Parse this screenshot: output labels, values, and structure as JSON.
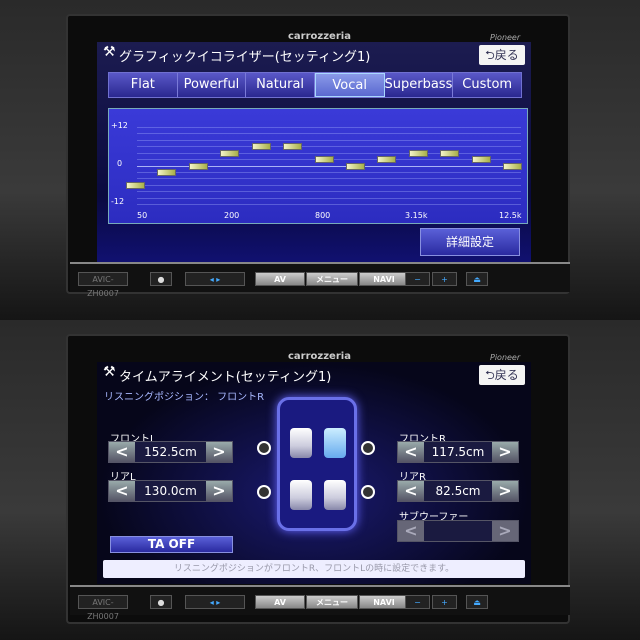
{
  "brand": "carrozzeria",
  "maker": "Pioneer",
  "model": "AVIC-ZH0007",
  "hard_buttons": {
    "av": "AV",
    "menu": "メニュー",
    "navi": "NAVI",
    "minus": "−",
    "plus": "+"
  },
  "eq": {
    "title": "グラフィックイコライザー(セッティング1)",
    "back": "戻る",
    "tabs": [
      "Flat",
      "Powerful",
      "Natural",
      "Vocal",
      "Superbass",
      "Custom"
    ],
    "active_tab": "Vocal",
    "y_labels": [
      "+12",
      "0",
      "-12"
    ],
    "x_labels": [
      "50",
      "200",
      "800",
      "3.15k",
      "12.5k"
    ],
    "detail_button": "詳細設定",
    "chart_data": {
      "type": "bar",
      "ylim": [
        -12,
        12
      ],
      "values": [
        -6,
        -2,
        0,
        4,
        6,
        6,
        2,
        0,
        2,
        4,
        4,
        2,
        0
      ],
      "x_tick_labels": [
        "50",
        "200",
        "800",
        "3.15k",
        "12.5k"
      ],
      "grid": true
    }
  },
  "ta": {
    "title": "タイムアライメント(セッティング1)",
    "back": "戻る",
    "listening": "リスニングポジション： フロントR",
    "front_l": {
      "label": "フロントL",
      "value": "152.5cm"
    },
    "rear_l": {
      "label": "リアL",
      "value": "130.0cm"
    },
    "front_r": {
      "label": "フロントR",
      "value": "117.5cm"
    },
    "rear_r": {
      "label": "リアR",
      "value": "82.5cm"
    },
    "sub": {
      "label": "サブウーファー",
      "value": ""
    },
    "ta_button": "TA OFF",
    "message": "リスニングポジションがフロントR、フロントLの時に設定できます。",
    "left": "<",
    "right": ">"
  }
}
